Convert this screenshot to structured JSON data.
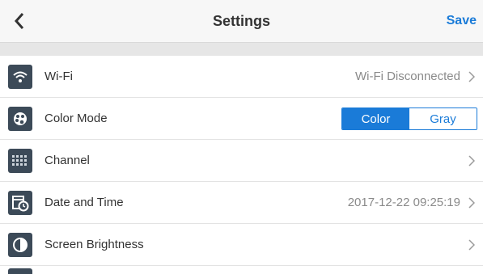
{
  "header": {
    "title": "Settings",
    "save_label": "Save"
  },
  "rows": [
    {
      "label": "Wi-Fi",
      "value": "Wi-Fi Disconnected",
      "icon": "wifi-icon"
    },
    {
      "label": "Color Mode",
      "icon": "palette-icon",
      "segmented": {
        "options": [
          "Color",
          "Gray"
        ],
        "selected": "Color"
      }
    },
    {
      "label": "Channel",
      "value": "",
      "icon": "channel-icon"
    },
    {
      "label": "Date and Time",
      "value": "2017-12-22 09:25:19",
      "icon": "calendar-clock-icon"
    },
    {
      "label": "Screen Brightness",
      "value": "",
      "icon": "brightness-icon"
    }
  ],
  "colors": {
    "accent": "#1a7bd8",
    "icon_bg": "#3c4a58"
  }
}
